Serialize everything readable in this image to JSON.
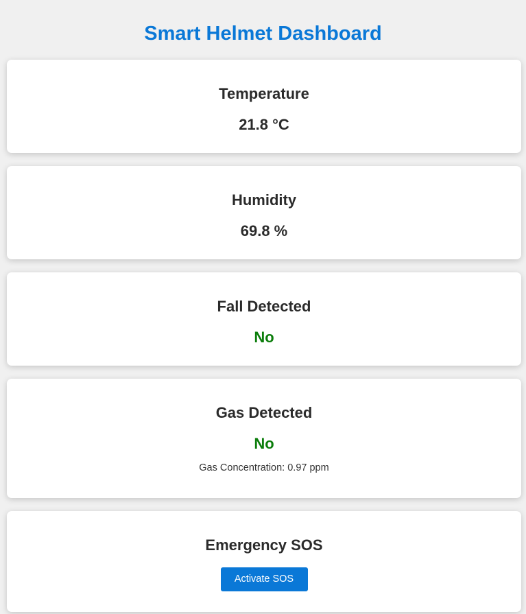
{
  "header": {
    "title": "Smart Helmet Dashboard"
  },
  "cards": {
    "temperature": {
      "title": "Temperature",
      "value": "21.8 °C"
    },
    "humidity": {
      "title": "Humidity",
      "value": "69.8 %"
    },
    "fall": {
      "title": "Fall Detected",
      "value": "No",
      "value_color": "#0b7d0b"
    },
    "gas": {
      "title": "Gas Detected",
      "value": "No",
      "value_color": "#0b7d0b",
      "concentration": "Gas Concentration: 0.97 ppm"
    },
    "sos": {
      "title": "Emergency SOS",
      "button_label": "Activate SOS",
      "button_color": "#0a78d7"
    }
  },
  "theme": {
    "accent": "#0a78d7",
    "background": "#f0f0f0",
    "card_background": "#ffffff"
  }
}
